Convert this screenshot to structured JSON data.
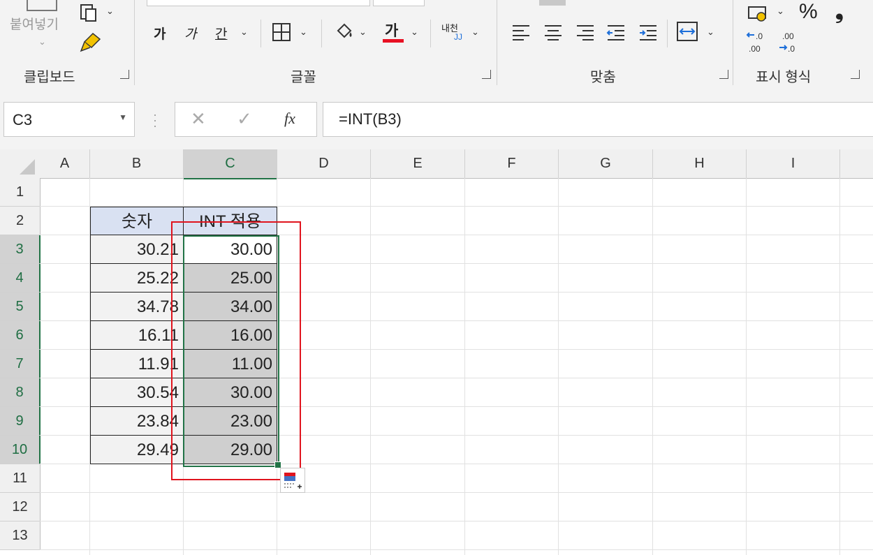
{
  "ribbon": {
    "clipboard": {
      "paste_label": "붙여넣기",
      "group_label": "클립보드"
    },
    "font": {
      "bold": "가",
      "italic": "가",
      "underline": "간",
      "font_color_glyph": "가",
      "phonetic_top": "내천",
      "phonetic_bottom": "JJ",
      "group_label": "글꼴",
      "font_color": "#e81123"
    },
    "alignment": {
      "group_label": "맞춤"
    },
    "number": {
      "percent": "%",
      "comma": "❟",
      "group_label": "표시 형식"
    }
  },
  "formula_bar": {
    "name_box": "C3",
    "fx": "fx",
    "formula": "=INT(B3)"
  },
  "sheet": {
    "columns": [
      "A",
      "B",
      "C",
      "D",
      "E",
      "F",
      "G",
      "H",
      "I"
    ],
    "rows": [
      "1",
      "2",
      "3",
      "4",
      "5",
      "6",
      "7",
      "8",
      "9",
      "10",
      "11",
      "12",
      "13"
    ],
    "header": {
      "b": "숫자",
      "c": "INT 적용"
    },
    "data": [
      {
        "b": "30.21",
        "c": "30.00"
      },
      {
        "b": "25.22",
        "c": "25.00"
      },
      {
        "b": "34.78",
        "c": "34.00"
      },
      {
        "b": "16.11",
        "c": "16.00"
      },
      {
        "b": "11.91",
        "c": "11.00"
      },
      {
        "b": "30.54",
        "c": "30.00"
      },
      {
        "b": "23.84",
        "c": "23.00"
      },
      {
        "b": "29.49",
        "c": "29.00"
      }
    ],
    "colors": {
      "selection": "#217346",
      "highlight_box": "#e0141e",
      "header_fill": "#d9e1f2"
    }
  }
}
